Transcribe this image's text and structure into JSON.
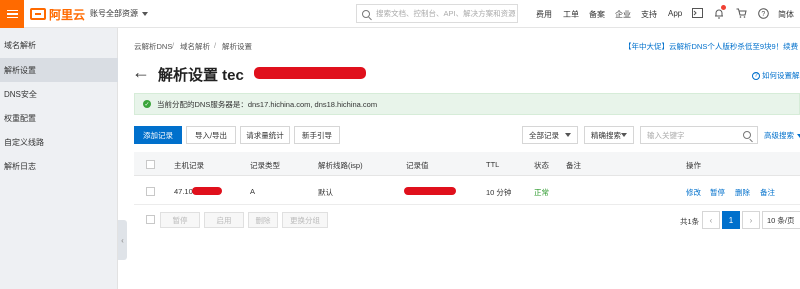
{
  "topbar": {
    "logo_text": "阿里云",
    "account": "账号全部资源",
    "search_placeholder": "搜索文档、控制台、API、解决方案和资源",
    "nav": [
      "费用",
      "工单",
      "备案",
      "企业",
      "支持",
      "App"
    ],
    "lang": "简体"
  },
  "sidebar": {
    "title": "域名解析",
    "items": [
      "解析设置",
      "DNS安全",
      "权重配置",
      "自定义线路",
      "解析日志"
    ]
  },
  "breadcrumb": [
    "云解析DNS",
    "域名解析",
    "解析设置"
  ],
  "promo": "【年中大促】云解析DNS个人版秒杀低至9块9！续费",
  "page": {
    "title": "解析设置 tec",
    "help": "如何设置解析"
  },
  "notice": "当前分配的DNS服务器是：dns17.hichina.com, dns18.hichina.com",
  "toolbar": {
    "add": "添加记录",
    "import_export": "导入/导出",
    "stats": "请求量统计",
    "guide": "新手引导",
    "filter": "全部记录",
    "exact": "精确搜索",
    "search_placeholder": "输入关键字",
    "advanced": "高级搜索"
  },
  "table": {
    "headers": [
      "主机记录",
      "记录类型",
      "解析线路(isp)",
      "记录值",
      "TTL",
      "状态",
      "备注",
      "操作"
    ],
    "rows": [
      {
        "host": "47.10",
        "type": "A",
        "line": "默认",
        "value": "",
        "ttl": "10 分钟",
        "status": "正常",
        "remark": "",
        "ops": [
          "修改",
          "暂停",
          "删除",
          "备注"
        ]
      }
    ]
  },
  "batch": [
    "暂停",
    "启用",
    "删除",
    "更换分组"
  ],
  "pager": {
    "total": "共1条",
    "prev": "‹",
    "current": "1",
    "next": "›",
    "size": "10 条/页"
  }
}
